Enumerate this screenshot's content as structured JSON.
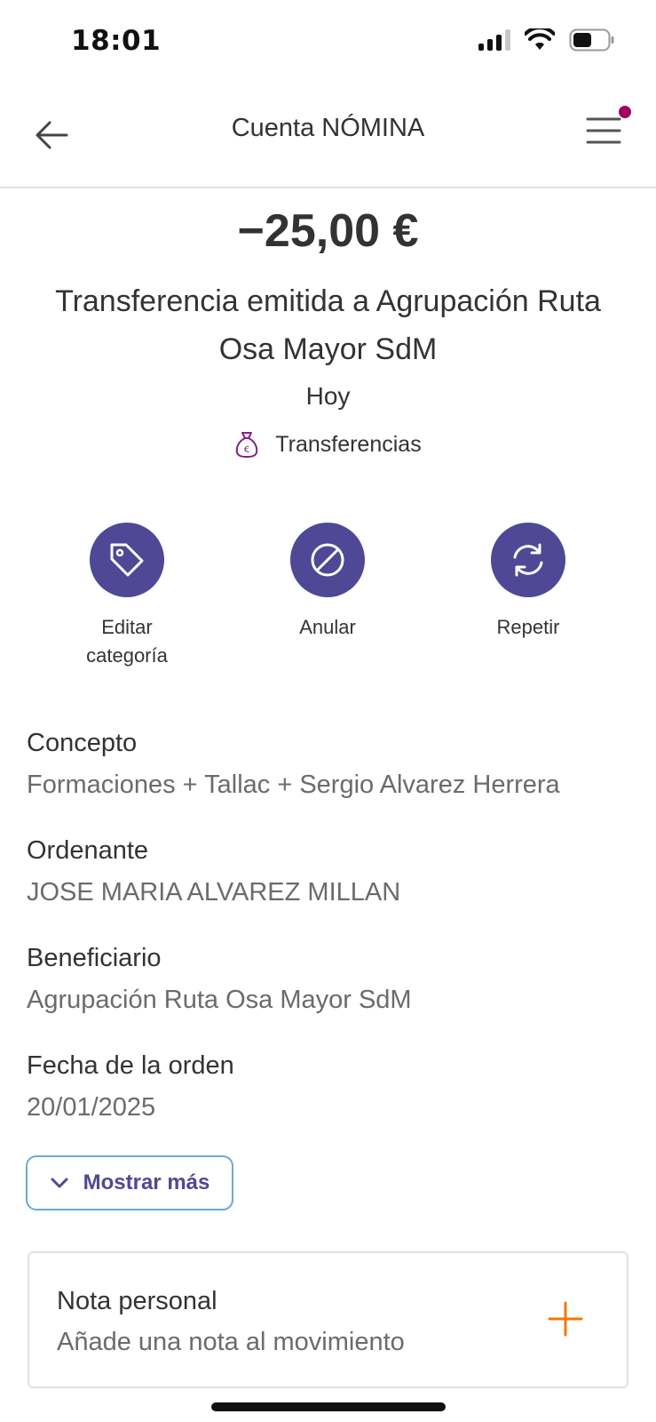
{
  "status_bar": {
    "time": "18:01"
  },
  "header": {
    "title": "Cuenta NÓMINA"
  },
  "transaction": {
    "amount": "−25,00 €",
    "description": "Transferencia emitida a Agrupación Ruta Osa Mayor SdM",
    "date": "Hoy",
    "category": "Transferencias"
  },
  "actions": [
    {
      "label_line1": "Editar",
      "label_line2": "categoría",
      "icon": "tag-icon"
    },
    {
      "label_line1": "Anular",
      "label_line2": "",
      "icon": "cancel-icon"
    },
    {
      "label_line1": "Repetir",
      "label_line2": "",
      "icon": "repeat-icon"
    }
  ],
  "details": [
    {
      "label": "Concepto",
      "value": "Formaciones + Tallac + Sergio Alvarez Herrera"
    },
    {
      "label": "Ordenante",
      "value": "JOSE MARIA ALVAREZ MILLAN"
    },
    {
      "label": "Beneficiario",
      "value": "Agrupación Ruta Osa Mayor SdM"
    },
    {
      "label": "Fecha de la orden",
      "value": "20/01/2025"
    }
  ],
  "show_more": {
    "label": "Mostrar más"
  },
  "note": {
    "title": "Nota personal",
    "placeholder": "Añade una nota al movimiento"
  },
  "colors": {
    "primary": "#4e4896",
    "accent_orange": "#f07800",
    "notification_dot": "#a3005f",
    "category_icon": "#8a1a8a"
  }
}
